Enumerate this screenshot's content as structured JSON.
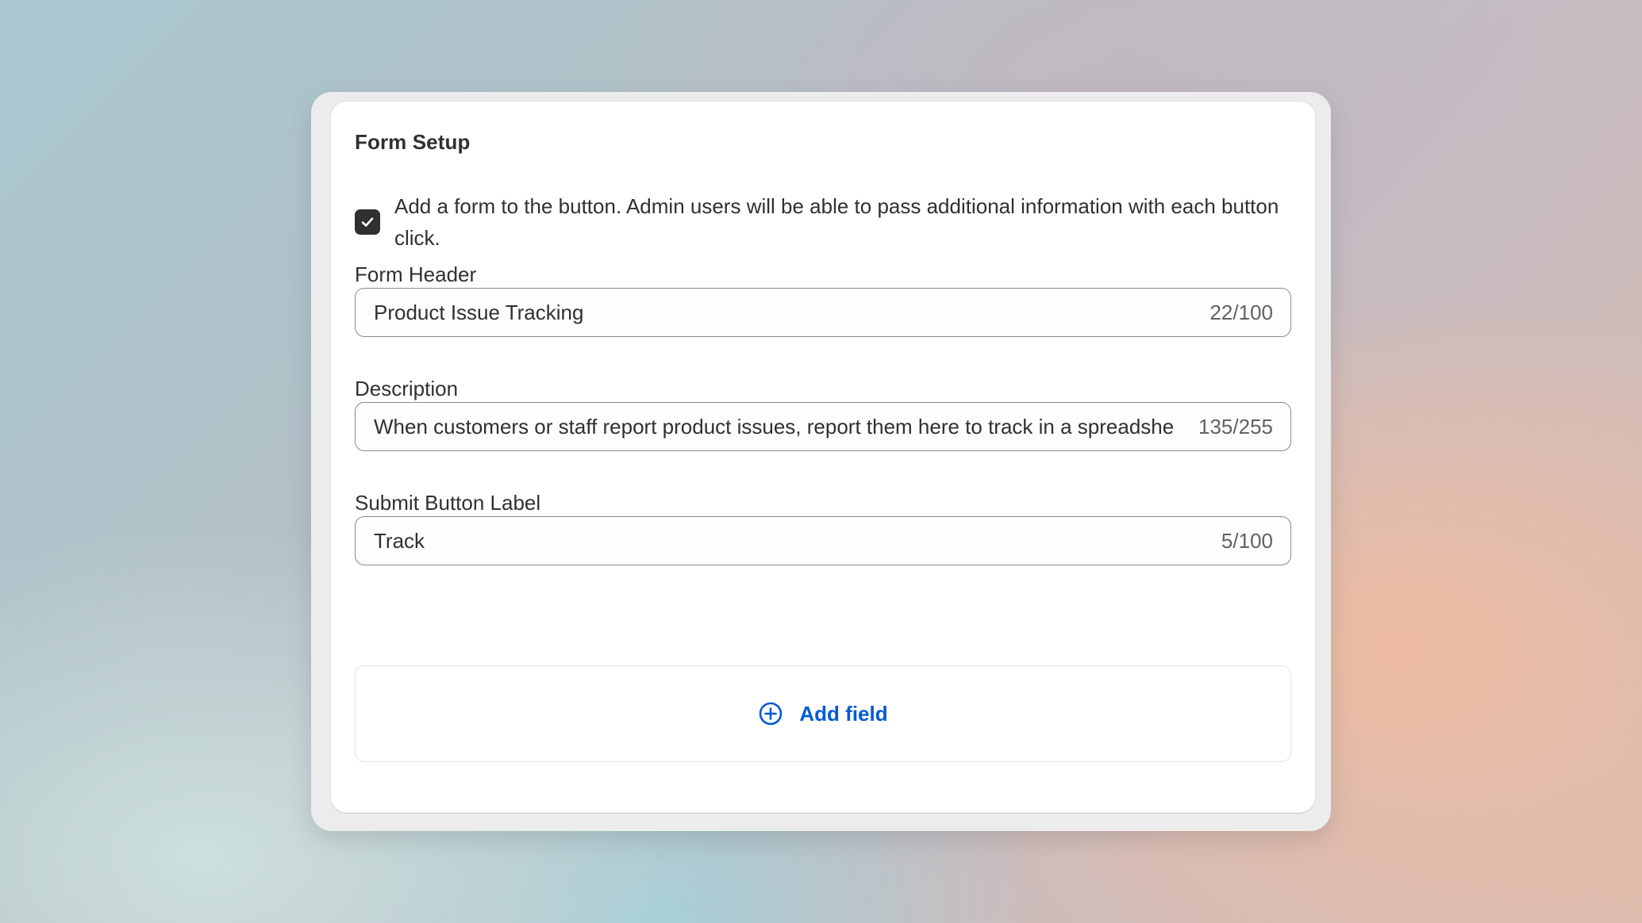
{
  "form_setup": {
    "title": "Form Setup",
    "add_form_checkbox": {
      "checked": true,
      "label": "Add a form to the button. Admin users will be able to pass additional information with each button click."
    },
    "fields": [
      {
        "label": "Form Header",
        "value": "Product Issue Tracking",
        "count": "22/100"
      },
      {
        "label": "Description",
        "value": "When customers or staff report product issues, report them here to track in a spreadsheet",
        "count": "135/255"
      },
      {
        "label": "Submit Button Label",
        "value": "Track",
        "count": "5/100"
      }
    ],
    "add_field": {
      "label": "Add field",
      "icon": "plus-circle-icon"
    }
  },
  "colors": {
    "text_primary": "#303030",
    "text_secondary": "#616161",
    "checkbox_fill": "#303030",
    "link_blue": "#005bd3",
    "input_border": "#8a8a8a"
  }
}
